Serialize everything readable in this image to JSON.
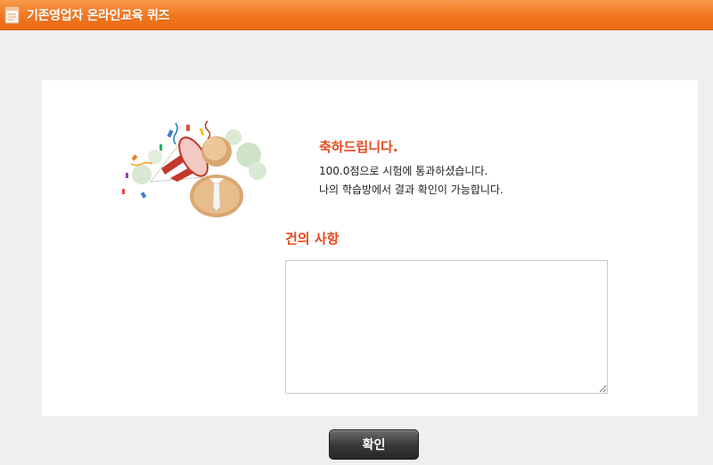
{
  "window": {
    "title": "기존영업자 온라인교육 퀴즈",
    "icon": "document-icon",
    "accent_color": "#f1771f"
  },
  "result": {
    "heading": "축하드립니다.",
    "score_message": "100.0점으로 시험에 통과하셨습니다.",
    "info_message": "나의 학습방에서 결과 확인이 가능합니다.",
    "illustration": "celebration-person-icon",
    "heading_color": "#e8481f"
  },
  "suggestion": {
    "heading": "건의 사항",
    "value": "",
    "placeholder": ""
  },
  "footer": {
    "confirm_label": "확인"
  }
}
